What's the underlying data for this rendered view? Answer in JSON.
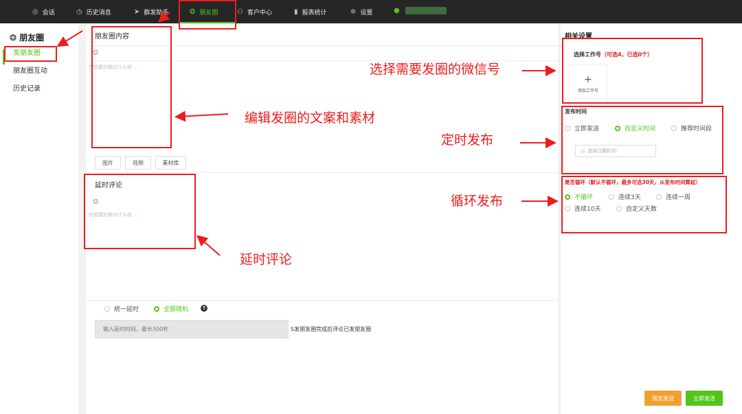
{
  "nav": {
    "items": [
      {
        "label": "会话",
        "icon": "chat-icon",
        "glyph": "◎"
      },
      {
        "label": "历史消息",
        "icon": "clock-icon",
        "glyph": "◷"
      },
      {
        "label": "群发助手",
        "icon": "send-icon",
        "glyph": "➤"
      },
      {
        "label": "朋友圈",
        "icon": "moments-icon",
        "glyph": "❂"
      },
      {
        "label": "客户中心",
        "icon": "user-icon",
        "glyph": "⚇"
      },
      {
        "label": "报表统计",
        "icon": "bar-chart-icon",
        "glyph": "▮"
      },
      {
        "label": "设置",
        "icon": "gear-icon",
        "glyph": "✲"
      }
    ],
    "active": "朋友圈",
    "user_icon": "person-icon",
    "colors": {
      "bg": "#262626",
      "accent": "#52c41a"
    }
  },
  "sidebar": {
    "title": "朋友圈",
    "title_glyph": "❂",
    "items": [
      {
        "label": "发朋友圈"
      },
      {
        "label": "朋友圈互动"
      },
      {
        "label": "历史记录"
      }
    ]
  },
  "moments": {
    "title": "朋友圈内容",
    "emoji_glyph": "☺",
    "placeholder": "你想要的聊点什么呢 ...",
    "buttons": [
      "图片",
      "视频",
      "素材库"
    ]
  },
  "comment": {
    "title": "延时评论",
    "emoji_glyph": "☺",
    "placeholder": "你想要的聊点什么呢 ..."
  },
  "delay": {
    "options": [
      "统一延时",
      "全部随机"
    ],
    "selected": "全部随机",
    "help": "?",
    "input_placeholder": "输入延时时间，最长300秒",
    "note": "S发朋友圈完成后评论已发朋友圈"
  },
  "settings": {
    "title": "相关设置",
    "account_label": "选择工作号",
    "account_hint": "（可选4，已选0个）",
    "add_plus": "+",
    "add_label": "添加工作号",
    "publish_time_label": "发布时间",
    "time_options": [
      "立即发送",
      "自定义时间",
      "推荐时间段"
    ],
    "time_selected": "自定义时间",
    "date_placeholder": "选择日期时间",
    "date_icon": "clock-icon",
    "loop_label": "是否循环（默认不循环，最多可选30天，从发布时间算起）",
    "loop_options": [
      "不循环",
      "连续3天",
      "连续一周",
      "连续10天",
      "自定义天数"
    ],
    "loop_selected": "不循环",
    "preview_button": "预览发送",
    "send_button": "立即发送",
    "colors": {
      "preview": "#f0a030",
      "send": "#52c41a",
      "hint": "#e02020"
    }
  },
  "annotations": {
    "select_account": "选择需要发圈的微信号",
    "edit_content": "编辑发圈的文案和素材",
    "scheduled": "定时发布",
    "loop": "循环发布",
    "delay_comment": "延时评论",
    "color": "#ee1c1c"
  }
}
